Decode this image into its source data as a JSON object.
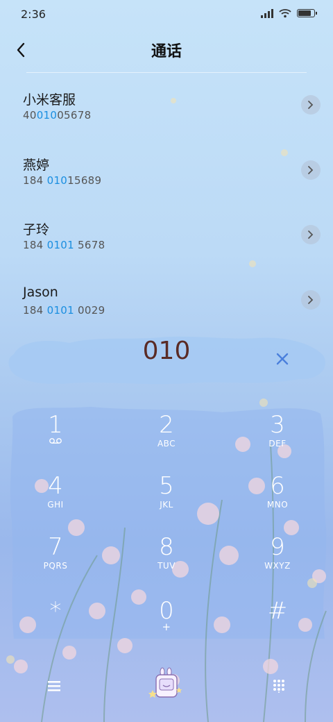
{
  "status": {
    "time": "2:36",
    "signal_icon": "signal-icon",
    "wifi_icon": "wifi-icon",
    "battery_icon": "battery-icon",
    "battery_level": 0.9
  },
  "header": {
    "title": "通话",
    "back_icon": "back-arrow-icon"
  },
  "query": "010",
  "results": [
    {
      "name": "小米客服",
      "number_before": "400",
      "number_match": "1005678",
      "match_part": "010",
      "display": [
        "40",
        "010",
        "05678"
      ]
    },
    {
      "name": "燕婷",
      "display": [
        "184 ",
        "010",
        "15689"
      ]
    },
    {
      "name": "子玲",
      "display": [
        "184 ",
        "0101",
        " 5678"
      ]
    },
    {
      "name": "Jason",
      "display": [
        "184 ",
        "0101",
        " 0029"
      ]
    }
  ],
  "input": {
    "value": "010",
    "clear_icon": "clear-x-icon"
  },
  "keypad": [
    {
      "digit": "1",
      "letters": "",
      "sub_icon": "voicemail-icon"
    },
    {
      "digit": "2",
      "letters": "ABC"
    },
    {
      "digit": "3",
      "letters": "DEF"
    },
    {
      "digit": "4",
      "letters": "GHI"
    },
    {
      "digit": "5",
      "letters": "JKL"
    },
    {
      "digit": "6",
      "letters": "MNO"
    },
    {
      "digit": "7",
      "letters": "PQRS"
    },
    {
      "digit": "8",
      "letters": "TUV"
    },
    {
      "digit": "9",
      "letters": "WXYZ"
    },
    {
      "digit": "*",
      "letters": ""
    },
    {
      "digit": "0",
      "letters": "+"
    },
    {
      "digit": "#",
      "letters": ""
    }
  ],
  "bottom": {
    "menu_icon": "menu-icon",
    "avatar_icon": "theme-avatar-icon",
    "dialpad_icon": "dialpad-icon"
  },
  "colors": {
    "match_highlight": "#1a8ee0",
    "dialed_text": "#5a2b25",
    "clear_icon": "#4a7fdc"
  }
}
